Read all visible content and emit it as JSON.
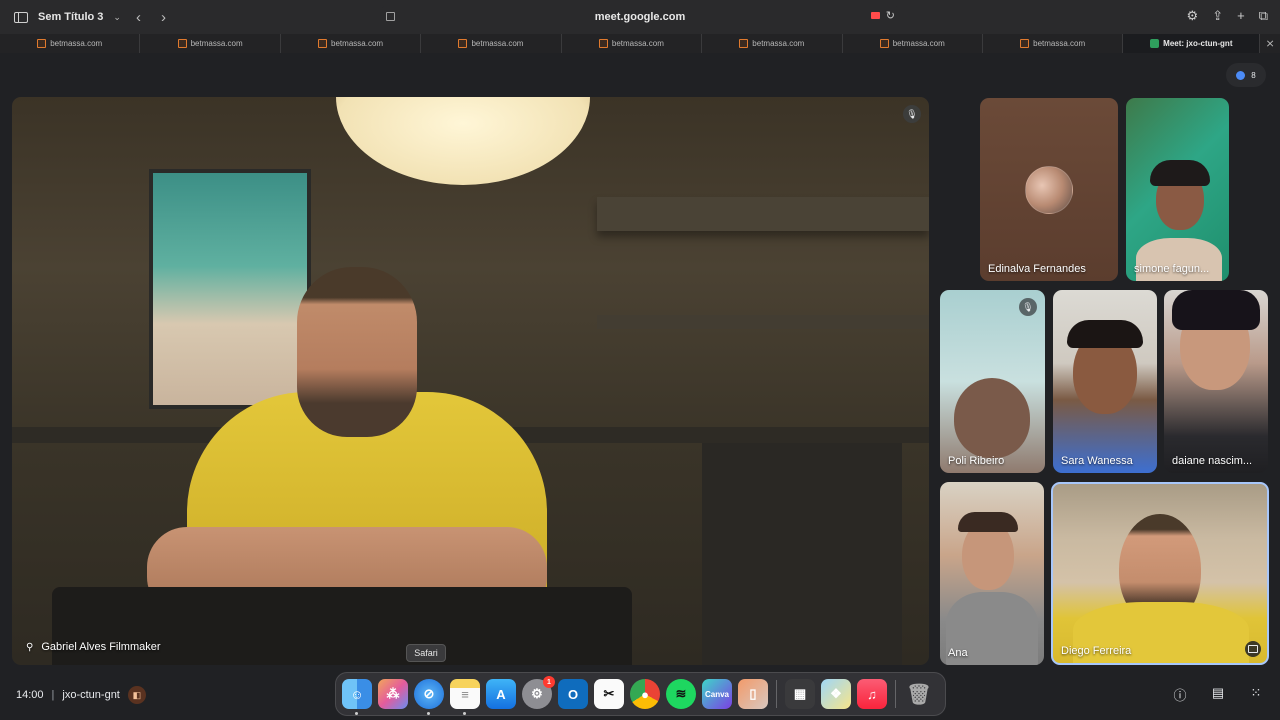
{
  "browser": {
    "tab_group_title": "Sem Título 3",
    "url": "meet.google.com",
    "tabs": [
      {
        "label": "betmassa.com"
      },
      {
        "label": "betmassa.com"
      },
      {
        "label": "betmassa.com"
      },
      {
        "label": "betmassa.com"
      },
      {
        "label": "betmassa.com"
      },
      {
        "label": "betmassa.com"
      },
      {
        "label": "betmassa.com"
      },
      {
        "label": "betmassa.com"
      },
      {
        "label": "Meet: jxo-ctun-gnt"
      }
    ]
  },
  "meet": {
    "participant_count": "8",
    "main_speaker": "Gabriel Alves Filmmaker",
    "participants": [
      {
        "name": "Edinalva Fernandes"
      },
      {
        "name": "simone fagun..."
      },
      {
        "name": "Poli Ribeiro"
      },
      {
        "name": "Sara Wanessa"
      },
      {
        "name": "daiane nascim..."
      },
      {
        "name": "Ana"
      },
      {
        "name": "Diego Ferreira"
      }
    ],
    "time": "14:00",
    "separator": "|",
    "meeting_code": "jxo-ctun-gnt"
  },
  "dock": {
    "tooltip": "Safari",
    "apps": [
      "Finder",
      "Launchpad",
      "Safari",
      "Notes",
      "App Store",
      "System Settings",
      "Outlook",
      "CapCut",
      "Chrome",
      "Spotify",
      "Canva",
      "iPhone Mirroring",
      "Calculator",
      "Preview",
      "Music",
      "Trash"
    ],
    "settings_badge": "1"
  },
  "colors": {
    "meet_bg": "#202124",
    "active_tile_border": "#a8c7fa",
    "camera_indicator": "#ff4b4b"
  }
}
